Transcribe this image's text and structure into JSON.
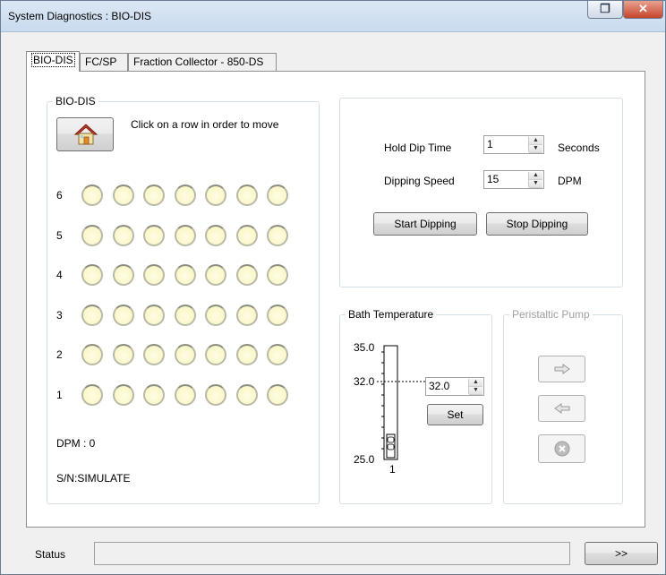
{
  "window": {
    "title": "System Diagnostics : BIO-DIS",
    "restore_icon": "restore-icon",
    "close_icon": "close-icon",
    "close_glyph": "✕",
    "restore_glyph": "❐"
  },
  "tabs": [
    {
      "label": "BIO-DIS",
      "active": true
    },
    {
      "label": "FC/SP",
      "active": false
    },
    {
      "label": "Fraction Collector - 850-DS",
      "active": false
    }
  ],
  "biodis": {
    "group_label": "BIO-DIS",
    "home_icon": "home-icon",
    "hint": "Click on a row in order to move",
    "rows": [
      "6",
      "5",
      "4",
      "3",
      "2",
      "1"
    ],
    "wells_per_row": 7,
    "dpm_text": "DPM : 0",
    "serial_text": "S/N:SIMULATE"
  },
  "dipping": {
    "hold_label": "Hold Dip Time",
    "hold_value": "1",
    "hold_unit": "Seconds",
    "speed_label": "Dipping Speed",
    "speed_value": "15",
    "speed_unit": "DPM",
    "start_label": "Start Dipping",
    "stop_label": "Stop Dipping"
  },
  "bath": {
    "group_label": "Bath Temperature",
    "scale_max": "35.0",
    "scale_setpoint": "32.0",
    "scale_min": "25.0",
    "channel": "1",
    "setpoint_value": "32.0",
    "set_label": "Set",
    "level_fraction": 0.1
  },
  "pump": {
    "group_label": "Peristaltic Pump",
    "forward_icon": "arrow-right-icon",
    "reverse_icon": "arrow-left-icon",
    "stop_icon": "stop-icon"
  },
  "status": {
    "label": "Status",
    "value": "",
    "expand_label": ">>"
  }
}
